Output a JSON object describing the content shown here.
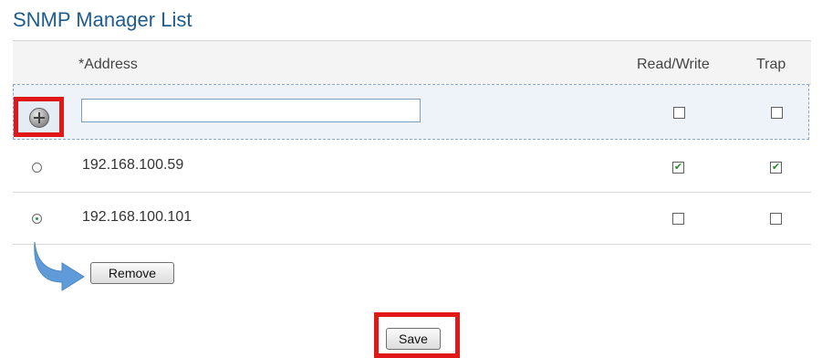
{
  "title": "SNMP Manager List",
  "columns": {
    "address": "*Address",
    "read_write": "Read/Write",
    "trap": "Trap"
  },
  "new_entry": {
    "address_value": "",
    "read_write": false,
    "trap": false
  },
  "managers": [
    {
      "address": "192.168.100.59",
      "selected": false,
      "read_write": true,
      "trap": true
    },
    {
      "address": "192.168.100.101",
      "selected": true,
      "read_write": false,
      "trap": false
    }
  ],
  "buttons": {
    "remove": "Remove",
    "save": "Save"
  },
  "icons": {
    "add": "plus-circle-icon",
    "pointer": "curved-arrow-icon"
  },
  "colors": {
    "title": "#1f5c8f",
    "highlight_frame": "#e21717",
    "arrow": "#5f9bd8"
  }
}
